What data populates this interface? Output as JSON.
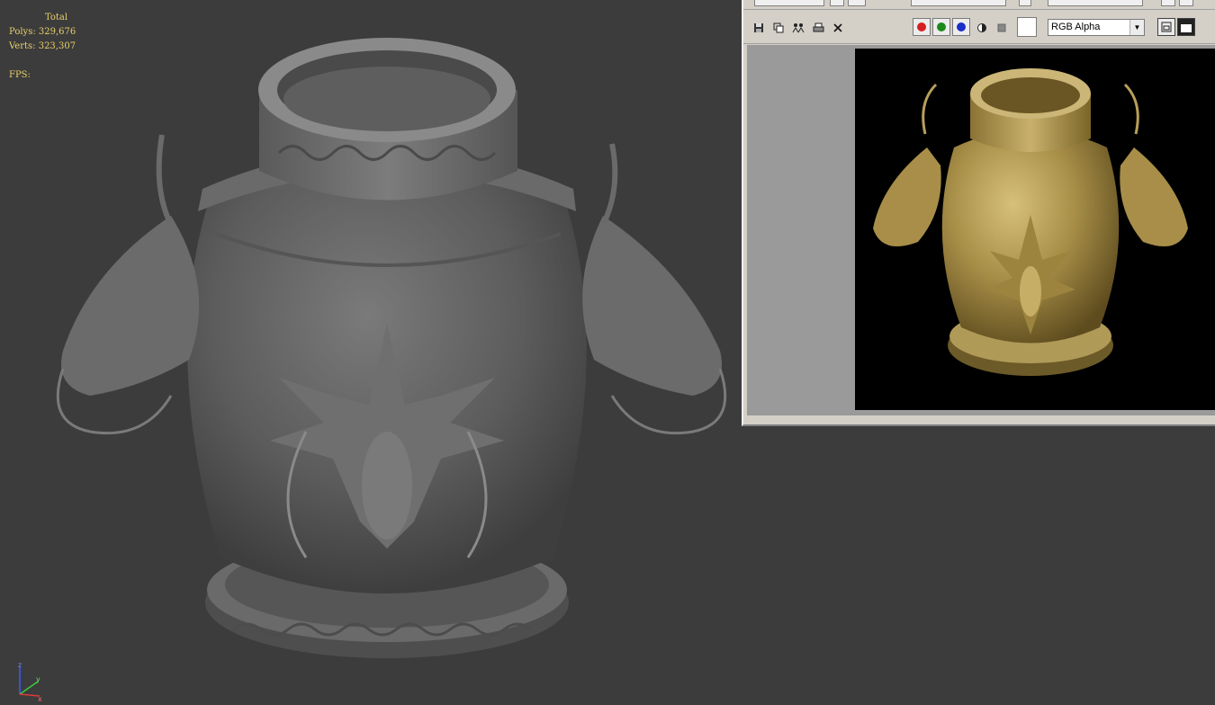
{
  "viewport": {
    "stats": {
      "total_label": "Total",
      "polys": "Polys: 329,676",
      "verts": "Verts: 323,307",
      "fps": "FPS:"
    },
    "axis_labels": {
      "x": "x",
      "y": "y",
      "z": "z"
    }
  },
  "frame_window": {
    "channel_select": "RGB Alpha",
    "icons": [
      "save-icon",
      "copy-icon",
      "clone-icon",
      "print-icon",
      "clear-icon"
    ],
    "channels": [
      {
        "name": "red",
        "color": "#d42020"
      },
      {
        "name": "green",
        "color": "#1a8a1a"
      },
      {
        "name": "blue",
        "color": "#1a2ec8"
      }
    ]
  },
  "colors": {
    "viewport_bg": "#3c3c3c",
    "stats_text": "#e8d06a",
    "window_chrome": "#d4d0c8"
  }
}
